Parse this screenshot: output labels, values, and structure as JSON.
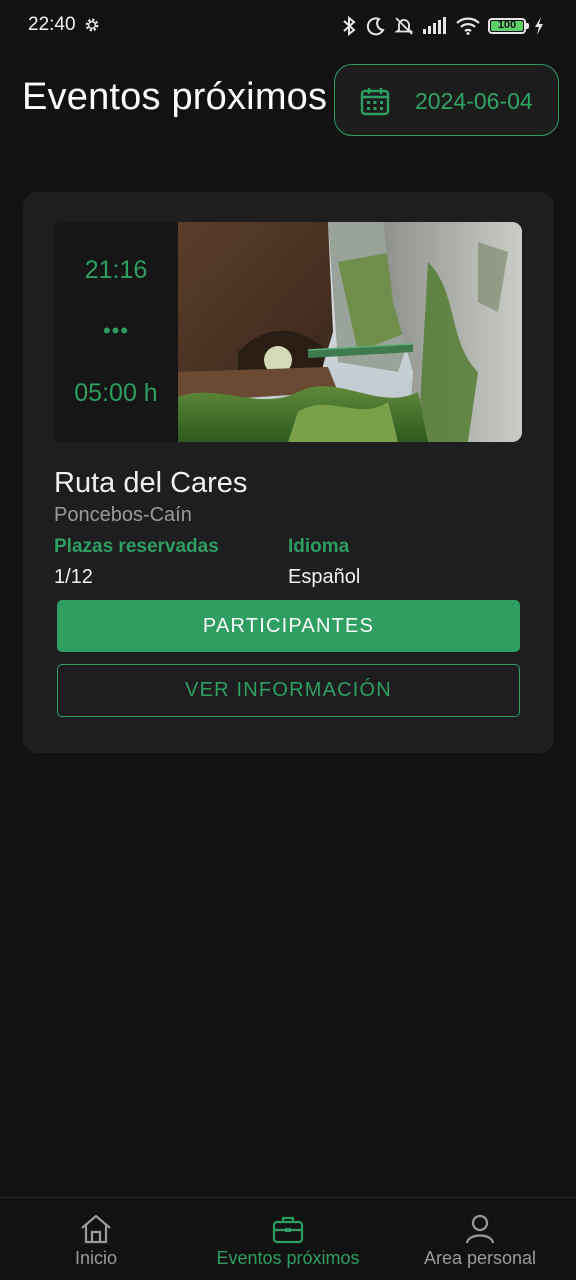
{
  "status_bar": {
    "time": "22:40",
    "battery": "100",
    "icons": [
      "gear-icon",
      "bluetooth-icon",
      "moon-icon",
      "bell-off-icon",
      "signal-icon",
      "wifi-icon",
      "battery-icon",
      "charging-icon"
    ]
  },
  "header": {
    "title": "Eventos próximos",
    "date": "2024-06-04",
    "date_icon": "calendar-icon"
  },
  "event": {
    "start_time": "21:16",
    "dots": "•••",
    "duration": "05:00 h",
    "name": "Ruta del Cares",
    "location": "Poncebos-Caín",
    "seats_label": "Plazas reservadas",
    "seats_value": "1/12",
    "language_label": "Idioma",
    "language_value": "Español",
    "participants_button": "PARTICIPANTES",
    "info_button": "VER INFORMACIÓN"
  },
  "bottom_nav": {
    "items": [
      {
        "label": "Inicio",
        "icon": "home-icon",
        "active": false
      },
      {
        "label": "Eventos próximos",
        "icon": "briefcase-icon",
        "active": true
      },
      {
        "label": "Area personal",
        "icon": "person-icon",
        "active": false
      }
    ]
  },
  "colors": {
    "background": "#121212",
    "card": "#1e1e20",
    "accent": "#2e9e61",
    "text": "#f0f0f0",
    "muted": "#9a9a9a"
  }
}
